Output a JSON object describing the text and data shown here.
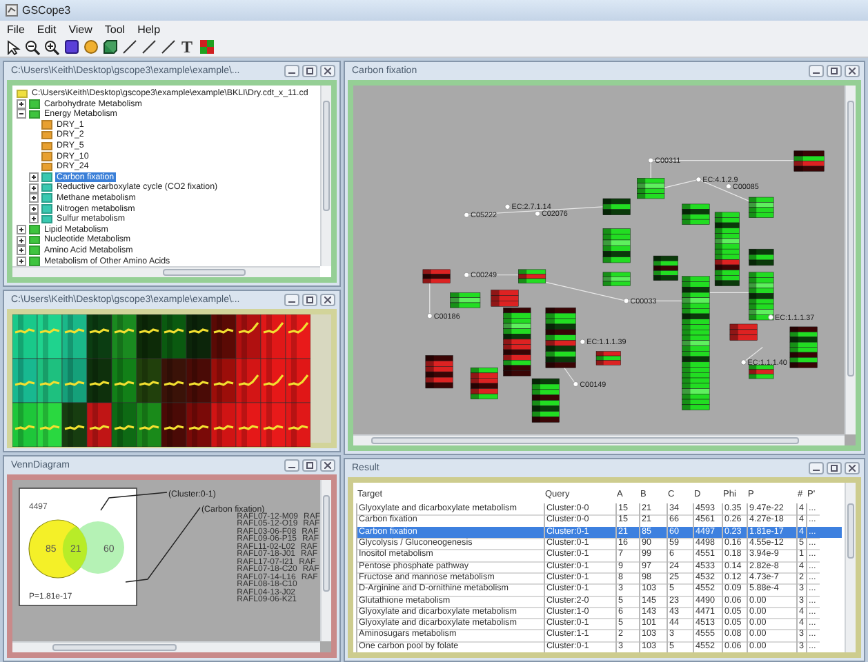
{
  "window": {
    "title": "GSCope3"
  },
  "menu": [
    "File",
    "Edit",
    "View",
    "Tool",
    "Help"
  ],
  "toolbar": [
    {
      "kind": "select"
    },
    {
      "kind": "zoom-out"
    },
    {
      "kind": "zoom-in"
    },
    {
      "kind": "rect"
    },
    {
      "kind": "ellipse"
    },
    {
      "kind": "cube"
    },
    {
      "kind": "line"
    },
    {
      "kind": "line"
    },
    {
      "kind": "line"
    },
    {
      "kind": "text",
      "label": "T"
    },
    {
      "kind": "heatmap"
    }
  ],
  "tree_window": {
    "title": "C:\\Users\\Keith\\Desktop\\gscope3\\example\\example\\..."
  },
  "tree": {
    "root": {
      "label": "C:\\Users\\Keith\\Desktop\\gscope3\\example\\example\\BKLI\\Dry.cdt_x_11.cd",
      "kind": "root",
      "selected": false,
      "children": [
        {
          "label": "Carbohydrate Metabolism",
          "kind": "category",
          "expanded": false,
          "selected": false
        },
        {
          "label": "Energy Metabolism",
          "kind": "category",
          "expanded": true,
          "selected": false,
          "children": [
            {
              "label": "DRY_1",
              "kind": "sample",
              "selected": false
            },
            {
              "label": "DRY_2",
              "kind": "sample",
              "selected": false
            },
            {
              "label": "DRY_5",
              "kind": "sample",
              "selected": false
            },
            {
              "label": "DRY_10",
              "kind": "sample",
              "selected": false
            },
            {
              "label": "DRY_24",
              "kind": "sample",
              "selected": false
            },
            {
              "label": "Carbon fixation",
              "kind": "pathway",
              "expanded": false,
              "selected": true
            },
            {
              "label": "Reductive carboxylate cycle (CO2 fixation)",
              "kind": "pathway",
              "expanded": false,
              "selected": false
            },
            {
              "label": "Methane metabolism",
              "kind": "pathway",
              "expanded": false,
              "selected": false
            },
            {
              "label": "Nitrogen metabolism",
              "kind": "pathway",
              "expanded": false,
              "selected": false
            },
            {
              "label": "Sulfur metabolism",
              "kind": "pathway",
              "expanded": false,
              "selected": false
            }
          ]
        },
        {
          "label": "Lipid Metabolism",
          "kind": "category",
          "expanded": false,
          "selected": false
        },
        {
          "label": "Nucleotide Metabolism",
          "kind": "category",
          "expanded": false,
          "selected": false
        },
        {
          "label": "Amino Acid Metabolism",
          "kind": "category",
          "expanded": false,
          "selected": false
        },
        {
          "label": "Metabolism of Other Amino Acids",
          "kind": "category",
          "expanded": false,
          "selected": false
        }
      ]
    }
  },
  "heatmap_window": {
    "title": "C:\\Users\\Keith\\Desktop\\gscope3\\example\\example\\..."
  },
  "venn_window": {
    "title": "VennDiagram"
  },
  "venn": {
    "total": "4497",
    "left_label": "(Cluster:0-1)",
    "right_label": "(Carbon fixation)",
    "left_only": "85",
    "both": "21",
    "right_only": "60",
    "p_value": "P=1.81e-17"
  },
  "gene_list": [
    {
      "name": "RAFL07-12-M09",
      "column_2": "RAF"
    },
    {
      "name": "RAFL05-12-O19",
      "column_2": "RAF"
    },
    {
      "name": "RAFL03-06-F08",
      "column_2": "RAF"
    },
    {
      "name": "RAFL09-06-P15",
      "column_2": "RAF"
    },
    {
      "name": "RAFL11-02-L02",
      "column_2": "RAF"
    },
    {
      "name": "RAFL07-18-J01",
      "column_2": "RAF"
    },
    {
      "name": "RAFL17-07-I21",
      "column_2": "RAF"
    },
    {
      "name": "RAFL07-18-C20",
      "column_2": "RAF"
    },
    {
      "name": "RAFL07-14-L16",
      "column_2": "RAF"
    },
    {
      "name": "RAFL08-18-C10"
    },
    {
      "name": "RAFL04-13-J02"
    },
    {
      "name": "RAFL09-06-K21"
    }
  ],
  "pathway_window": {
    "title": "Carbon fixation"
  },
  "pathway": {
    "nodes": [
      {
        "label": "C00311"
      },
      {
        "label": "C05222"
      },
      {
        "label": "EC:2.7.1.14"
      },
      {
        "label": "C02076"
      },
      {
        "label": "EC:4.1.2.9"
      },
      {
        "label": "C00085"
      },
      {
        "label": "C00249"
      },
      {
        "label": "C00033"
      },
      {
        "label": "C00186"
      },
      {
        "label": "C00149"
      },
      {
        "label": "EC:1.1.1.40"
      },
      {
        "label": "EC:1.1.1.37"
      },
      {
        "label": "EC:1.1.1.39"
      }
    ]
  },
  "result_window": {
    "title": "Result"
  },
  "table": {
    "columns": [
      "Target",
      "Query",
      "A",
      "B",
      "C",
      "D",
      "Phi",
      "P",
      "#",
      "P'"
    ],
    "rows": [
      {
        "selected": false,
        "cells": [
          "Glyoxylate and dicarboxylate metabolism",
          "Cluster:0-0",
          "15",
          "21",
          "34",
          "4593",
          "0.35",
          "9.47e-22",
          "4",
          "..."
        ]
      },
      {
        "selected": false,
        "cells": [
          "Carbon fixation",
          "Cluster:0-0",
          "15",
          "21",
          "66",
          "4561",
          "0.26",
          "4.27e-18",
          "4",
          "..."
        ]
      },
      {
        "selected": true,
        "cells": [
          "Carbon fixation",
          "Cluster:0-1",
          "21",
          "85",
          "60",
          "4497",
          "0.23",
          "1.81e-17",
          "4",
          "..."
        ]
      },
      {
        "selected": false,
        "cells": [
          "Glycolysis / Gluconeogenesis",
          "Cluster:0-1",
          "16",
          "90",
          "59",
          "4498",
          "0.16",
          "4.55e-12",
          "5",
          "..."
        ]
      },
      {
        "selected": false,
        "cells": [
          "Inositol metabolism",
          "Cluster:0-1",
          "7",
          "99",
          "6",
          "4551",
          "0.18",
          "3.94e-9",
          "1",
          "..."
        ]
      },
      {
        "selected": false,
        "cells": [
          "Pentose phosphate pathway",
          "Cluster:0-1",
          "9",
          "97",
          "24",
          "4533",
          "0.14",
          "2.82e-8",
          "4",
          "..."
        ]
      },
      {
        "selected": false,
        "cells": [
          "Fructose and mannose metabolism",
          "Cluster:0-1",
          "8",
          "98",
          "25",
          "4532",
          "0.12",
          "4.73e-7",
          "2",
          "..."
        ]
      },
      {
        "selected": false,
        "cells": [
          "D-Arginine and D-ornithine metabolism",
          "Cluster:0-1",
          "3",
          "103",
          "5",
          "4552",
          "0.09",
          "5.88e-4",
          "3",
          "..."
        ]
      },
      {
        "selected": false,
        "cells": [
          "Glutathione metabolism",
          "Cluster:2-0",
          "5",
          "145",
          "23",
          "4490",
          "0.06",
          "0.00",
          "3",
          "..."
        ]
      },
      {
        "selected": false,
        "cells": [
          "Glyoxylate and dicarboxylate metabolism",
          "Cluster:1-0",
          "6",
          "143",
          "43",
          "4471",
          "0.05",
          "0.00",
          "4",
          "..."
        ]
      },
      {
        "selected": false,
        "cells": [
          "Glyoxylate and dicarboxylate metabolism",
          "Cluster:0-1",
          "5",
          "101",
          "44",
          "4513",
          "0.05",
          "0.00",
          "4",
          "..."
        ]
      },
      {
        "selected": false,
        "cells": [
          "Aminosugars metabolism",
          "Cluster:1-1",
          "2",
          "103",
          "3",
          "4555",
          "0.08",
          "0.00",
          "3",
          "..."
        ]
      },
      {
        "selected": false,
        "cells": [
          "One carbon pool by folate",
          "Cluster:0-1",
          "3",
          "103",
          "5",
          "4552",
          "0.06",
          "0.00",
          "3",
          "..."
        ]
      }
    ]
  }
}
